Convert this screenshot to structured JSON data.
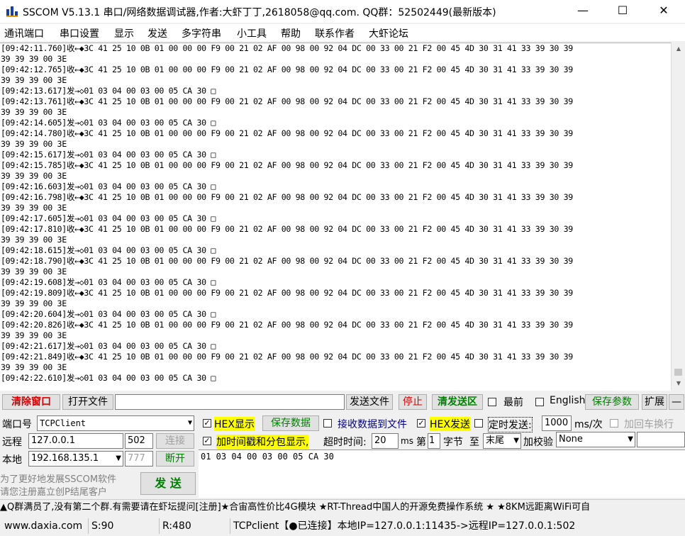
{
  "window": {
    "title": "SSCOM V5.13.1 串口/网络数据调试器,作者:大虾丁丁,2618058@qq.com. QQ群：52502449(最新版本)",
    "minimize": "—",
    "maximize": "☐",
    "close": "✕"
  },
  "menu": [
    "通讯端口",
    "串口设置",
    "显示",
    "发送",
    "多字符串",
    "小工具",
    "帮助",
    "联系作者",
    "大虾论坛"
  ],
  "log": [
    "[09:42:11.760]收←◆3C 41 25 10 0B 01 00 00 00 F9 00 21 02 AF 00 98 00 92 04 DC 00 33 00 21 F2 00 45 4D 30 31 41 33 39 30 39",
    "39 39 39 00 3E",
    "[09:42:12.765]收←◆3C 41 25 10 0B 01 00 00 00 F9 00 21 02 AF 00 98 00 92 04 DC 00 33 00 21 F2 00 45 4D 30 31 41 33 39 30 39",
    "39 39 39 00 3E",
    "[09:42:13.617]发→◇01 03 04 00 03 00 05 CA 30 □",
    "[09:42:13.761]收←◆3C 41 25 10 0B 01 00 00 00 F9 00 21 02 AF 00 98 00 92 04 DC 00 33 00 21 F2 00 45 4D 30 31 41 33 39 30 39",
    "39 39 39 00 3E",
    "[09:42:14.605]发→◇01 03 04 00 03 00 05 CA 30 □",
    "[09:42:14.780]收←◆3C 41 25 10 0B 01 00 00 00 F9 00 21 02 AF 00 98 00 92 04 DC 00 33 00 21 F2 00 45 4D 30 31 41 33 39 30 39",
    "39 39 39 00 3E",
    "[09:42:15.617]发→◇01 03 04 00 03 00 05 CA 30 □",
    "[09:42:15.785]收←◆3C 41 25 10 0B 01 00 00 00 F9 00 21 02 AF 00 98 00 92 04 DC 00 33 00 21 F2 00 45 4D 30 31 41 33 39 30 39",
    "39 39 39 00 3E",
    "[09:42:16.603]发→◇01 03 04 00 03 00 05 CA 30 □",
    "[09:42:16.798]收←◆3C 41 25 10 0B 01 00 00 00 F9 00 21 02 AF 00 98 00 92 04 DC 00 33 00 21 F2 00 45 4D 30 31 41 33 39 30 39",
    "39 39 39 00 3E",
    "[09:42:17.605]发→◇01 03 04 00 03 00 05 CA 30 □",
    "[09:42:17.810]收←◆3C 41 25 10 0B 01 00 00 00 F9 00 21 02 AF 00 98 00 92 04 DC 00 33 00 21 F2 00 45 4D 30 31 41 33 39 30 39",
    "39 39 39 00 3E",
    "[09:42:18.615]发→◇01 03 04 00 03 00 05 CA 30 □",
    "[09:42:18.790]收←◆3C 41 25 10 0B 01 00 00 00 F9 00 21 02 AF 00 98 00 92 04 DC 00 33 00 21 F2 00 45 4D 30 31 41 33 39 30 39",
    "39 39 39 00 3E",
    "[09:42:19.608]发→◇01 03 04 00 03 00 05 CA 30 □",
    "[09:42:19.809]收←◆3C 41 25 10 0B 01 00 00 00 F9 00 21 02 AF 00 98 00 92 04 DC 00 33 00 21 F2 00 45 4D 30 31 41 33 39 30 39",
    "39 39 39 00 3E",
    "[09:42:20.604]发→◇01 03 04 00 03 00 05 CA 30 □",
    "[09:42:20.826]收←◆3C 41 25 10 0B 01 00 00 00 F9 00 21 02 AF 00 98 00 92 04 DC 00 33 00 21 F2 00 45 4D 30 31 41 33 39 30 39",
    "39 39 39 00 3E",
    "[09:42:21.617]发→◇01 03 04 00 03 00 05 CA 30 □",
    "[09:42:21.849]收←◆3C 41 25 10 0B 01 00 00 00 F9 00 21 02 AF 00 98 00 92 04 DC 00 33 00 21 F2 00 45 4D 30 31 41 33 39 30 39",
    "39 39 39 00 3E",
    "[09:42:22.610]发→◇01 03 04 00 03 00 05 CA 30 □"
  ],
  "toolbar": {
    "clear_window": "清除窗口",
    "open_file": "打开文件",
    "file_path": "",
    "send_file": "发送文件",
    "stop": "停止",
    "clear_send": "清发送区",
    "frontmost_label": "最前",
    "english_label": "English",
    "save_params": "保存参数",
    "expand": "扩展",
    "collapse": "—"
  },
  "connection": {
    "port_label": "端口号",
    "port_value": "TCPClient",
    "remote_label": "远程",
    "remote_ip": "127.0.0.1",
    "remote_port": "502",
    "connect_button": "连接",
    "local_label": "本地",
    "local_ip": "192.168.135.1",
    "local_port": "777",
    "disconnect_button": "断开",
    "promo_line1": "为了更好地发展SSCOM软件",
    "promo_line2": "请您注册嘉立创P结尾客户",
    "send_button": "发 送"
  },
  "options": {
    "hex_display": "HEX显示",
    "save_data": "保存数据",
    "recv_to_file": "接收数据到文件",
    "hex_send": "HEX发送",
    "timed_send": "定时发送:",
    "interval": "1000",
    "interval_unit": "ms/次",
    "add_crlf": "加回车换行",
    "timestamp": "加时间戳和分包显示,",
    "timeout_label": "超时时间:",
    "timeout_value": "20",
    "timeout_unit": "ms",
    "byte_prefix": "第",
    "byte_index": "1",
    "byte_label": "字节",
    "to_label": "至",
    "end_value": "末尾",
    "checksum_label": "加校验",
    "checksum_value": "None"
  },
  "send_text": "01 03 04 00 03 00 05 CA 30",
  "ticker": "▲Q群满员了,没有第二个群.有需要请在虾坛提问[注册]★合宙高性价比4G模块 ★RT-Thread中国人的开源免费操作系统 ★ ★8KM远距离WiFi可自",
  "status": {
    "website": "www.daxia.com",
    "sent": "S:90",
    "received": "R:480",
    "connection": "TCPclient【●已连接】本地IP=127.0.0.1:11435->远程IP=127.0.0.1:502"
  }
}
